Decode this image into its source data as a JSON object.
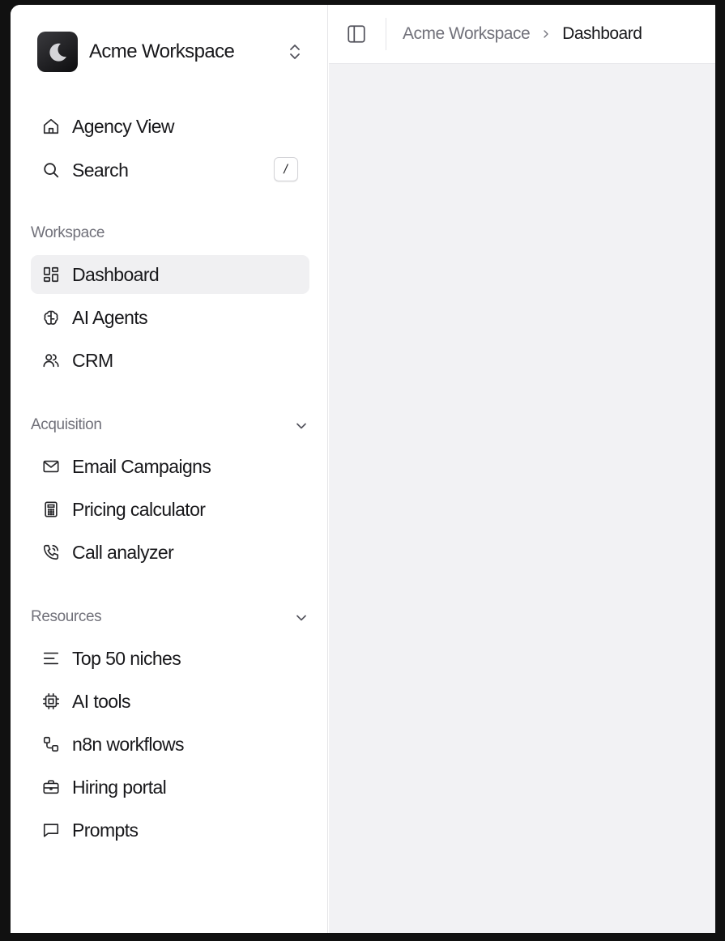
{
  "workspace": {
    "name": "Acme Workspace"
  },
  "breadcrumb": {
    "parent": "Acme Workspace",
    "current": "Dashboard"
  },
  "top_nav": [
    {
      "label": "Agency View",
      "icon": "home-icon"
    },
    {
      "label": "Search",
      "icon": "search-icon",
      "shortcut": "/"
    }
  ],
  "sections": {
    "workspace": {
      "label": "Workspace",
      "items": [
        {
          "label": "Dashboard",
          "icon": "dashboard-icon",
          "active": true
        },
        {
          "label": "AI Agents",
          "icon": "brain-icon"
        },
        {
          "label": "CRM",
          "icon": "users-icon"
        }
      ]
    },
    "acquisition": {
      "label": "Acquisition",
      "items": [
        {
          "label": "Email Campaigns",
          "icon": "mail-icon"
        },
        {
          "label": "Pricing calculator",
          "icon": "calculator-icon"
        },
        {
          "label": "Call analyzer",
          "icon": "phone-call-icon"
        }
      ]
    },
    "resources": {
      "label": "Resources",
      "items": [
        {
          "label": "Top 50 niches",
          "icon": "list-icon"
        },
        {
          "label": "AI tools",
          "icon": "cpu-icon"
        },
        {
          "label": "n8n workflows",
          "icon": "workflow-icon"
        },
        {
          "label": "Hiring portal",
          "icon": "briefcase-icon"
        },
        {
          "label": "Prompts",
          "icon": "message-square-icon"
        }
      ]
    }
  },
  "colors": {
    "active_item_bg": "#f0f0f2",
    "main_bg": "#f2f2f4",
    "logo_bg": "#1a1a1c"
  }
}
